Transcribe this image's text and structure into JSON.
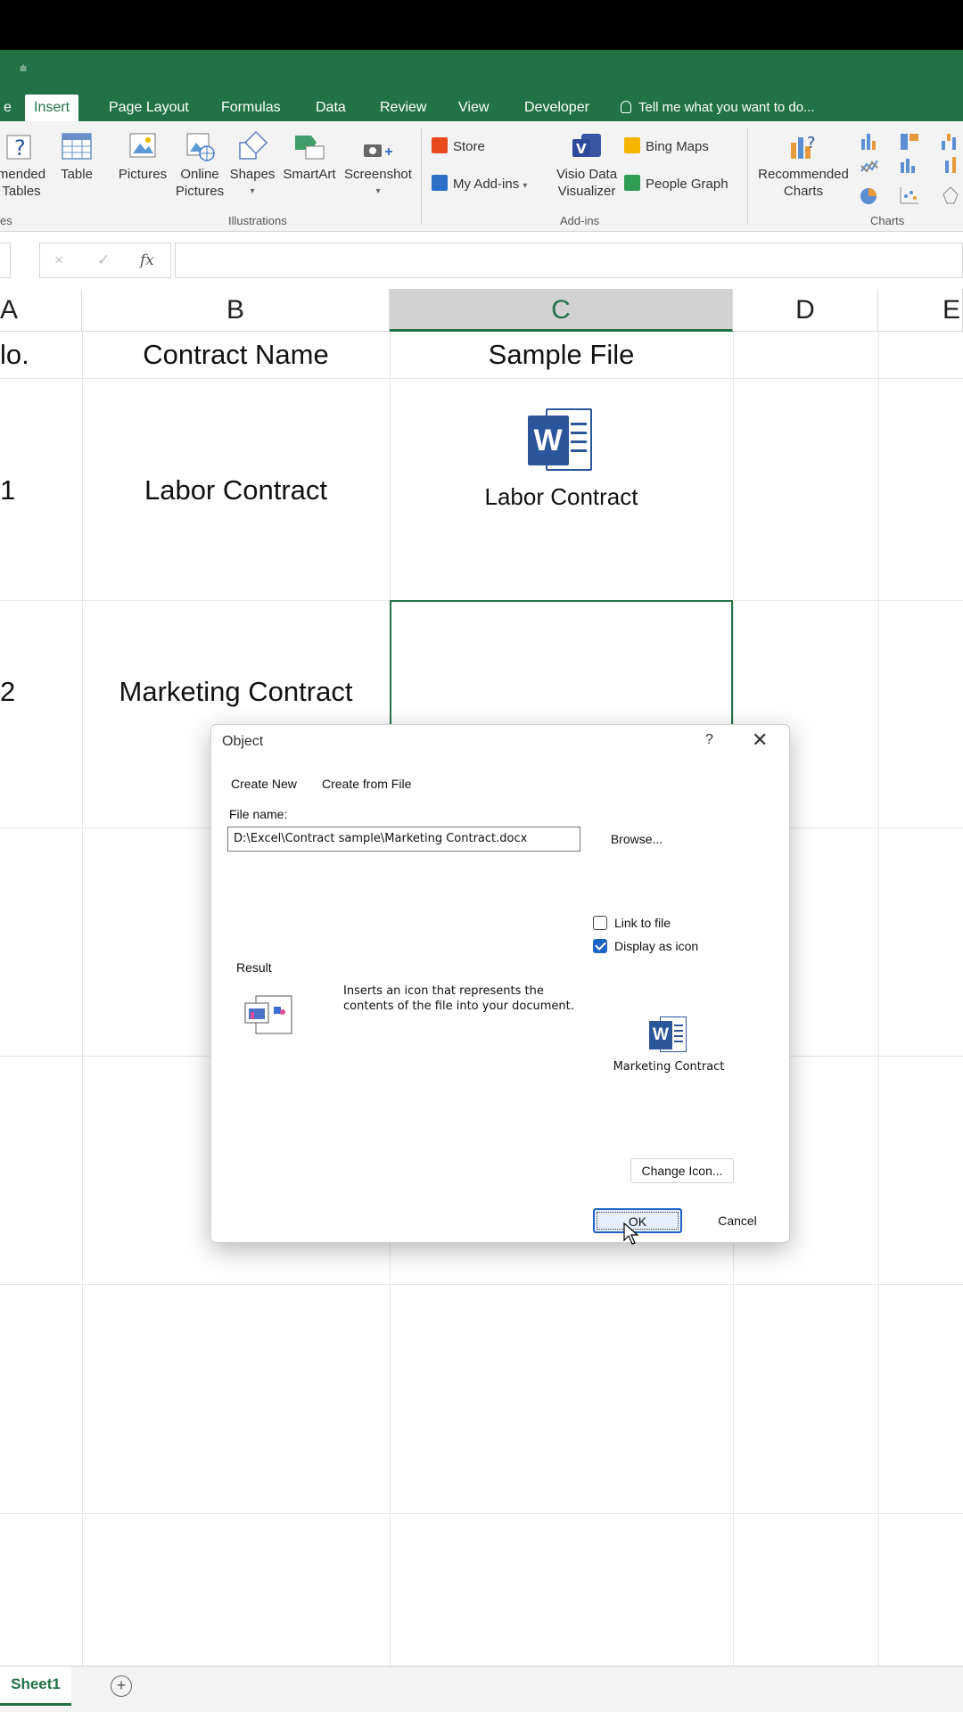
{
  "ribbon": {
    "tabs": [
      "e",
      "Insert",
      "Page Layout",
      "Formulas",
      "Data",
      "Review",
      "View",
      "Developer"
    ],
    "active_tab": "Insert",
    "tell_me": "Tell me what you want to do...",
    "buttons": {
      "rec_tables_1": "mended",
      "rec_tables_2": "Tables",
      "table": "Table",
      "pictures": "Pictures",
      "online_pictures_1": "Online",
      "online_pictures_2": "Pictures",
      "shapes": "Shapes",
      "smartart": "SmartArt",
      "screenshot": "Screenshot",
      "store": "Store",
      "my_addins": "My Add-ins",
      "visio_1": "Visio Data",
      "visio_2": "Visualizer",
      "bing_maps": "Bing Maps",
      "people_graph": "People Graph",
      "rec_charts_1": "Recommended",
      "rec_charts_2": "Charts"
    },
    "groups": {
      "tables_partial": "es",
      "illustrations": "Illustrations",
      "addins": "Add-ins",
      "charts": "Charts"
    }
  },
  "formula_bar": {
    "fx": "fx",
    "cancel": "×",
    "enter": "✓",
    "value": ""
  },
  "columns": [
    "A",
    "B",
    "C",
    "D",
    "E"
  ],
  "cells": {
    "a_header": "lo.",
    "b_header": "Contract Name",
    "c_header": "Sample File",
    "a1": "1",
    "b1": "Labor Contract",
    "c1_icon_label": "Labor Contract",
    "a2": "2",
    "b2": "Marketing Contract"
  },
  "dialog": {
    "title": "Object",
    "help": "?",
    "close": "✕",
    "tab_create_new": "Create New",
    "tab_create_from_file": "Create from File",
    "file_name_label": "File name:",
    "file_name_value": "D:\\Excel\\Contract sample\\Marketing Contract.docx",
    "browse": "Browse...",
    "link_to_file": "Link to file",
    "link_to_file_checked": false,
    "display_as_icon": "Display as icon",
    "display_as_icon_checked": true,
    "result_label": "Result",
    "result_text": "Inserts an icon that represents the contents of the file into your document.",
    "icon_caption": "Marketing Contract",
    "change_icon": "Change Icon...",
    "ok": "OK",
    "cancel": "Cancel"
  },
  "sheets": {
    "active": "Sheet1",
    "add": "+"
  },
  "colors": {
    "excel_green": "#217346",
    "word_blue": "#2b579a",
    "checkbox_blue": "#1e63c7"
  }
}
